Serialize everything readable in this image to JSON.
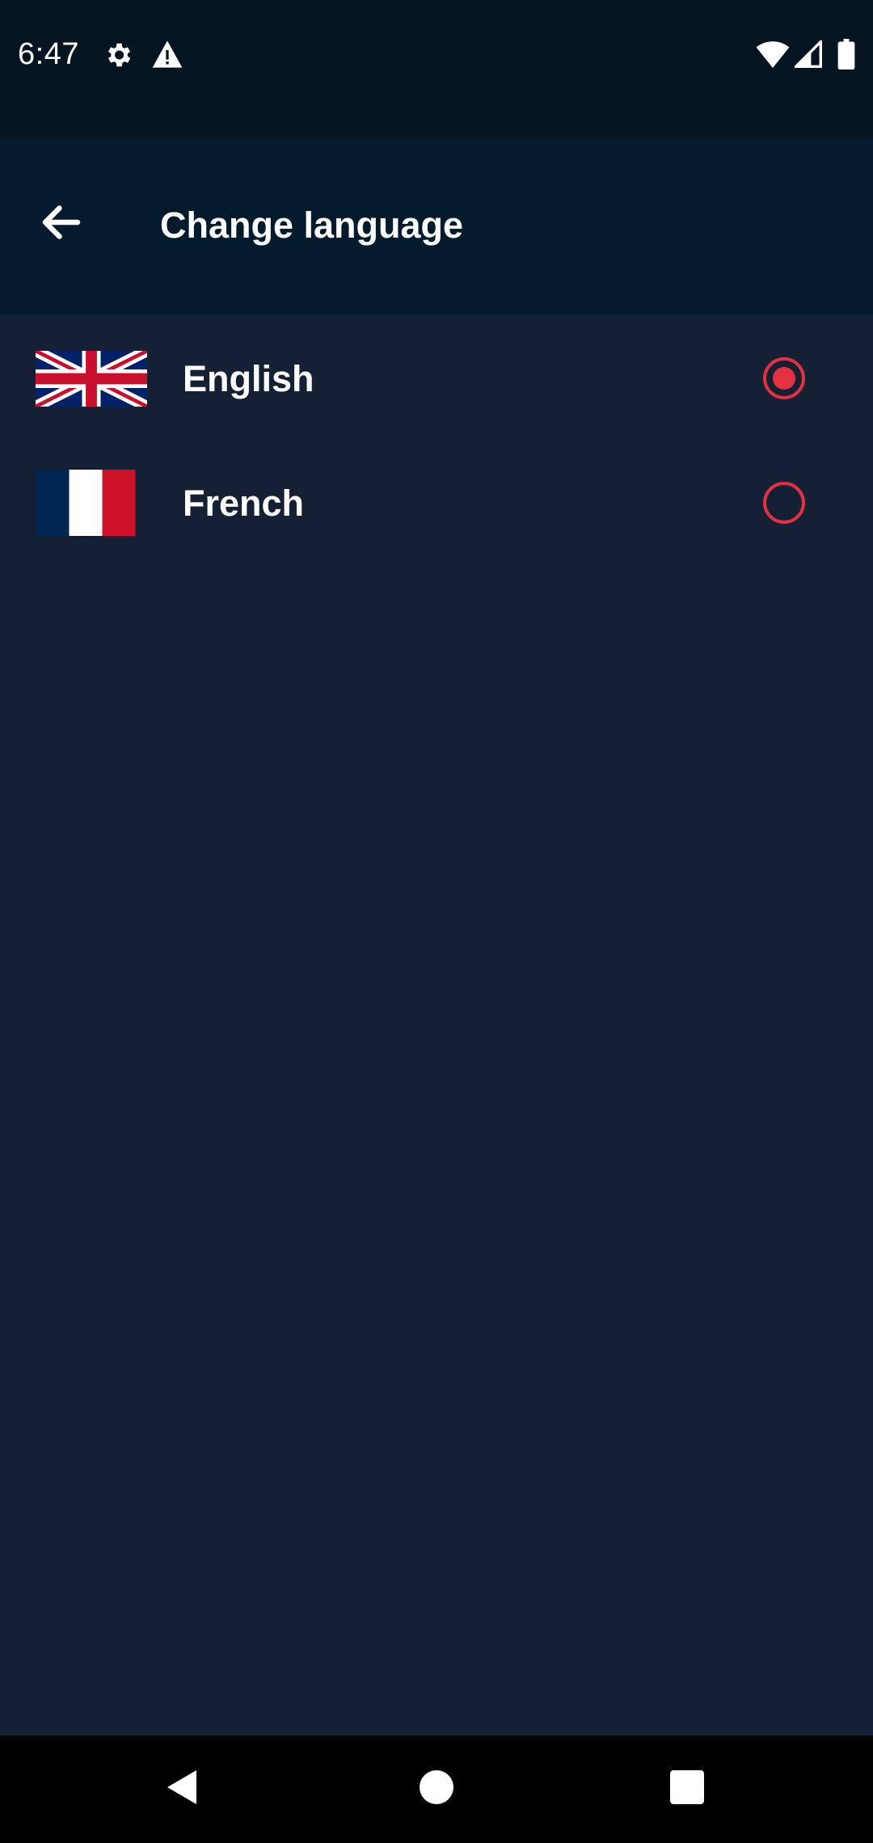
{
  "status_bar": {
    "time": "6:47",
    "icons": [
      "gear-icon",
      "warning-icon",
      "wifi-icon",
      "signal-icon",
      "battery-icon"
    ]
  },
  "app_bar": {
    "title": "Change language",
    "back_icon": "arrow-left-icon"
  },
  "languages": [
    {
      "label": "English",
      "flag": "uk-flag-icon",
      "selected": true
    },
    {
      "label": "French",
      "flag": "france-flag-icon",
      "selected": false
    }
  ],
  "nav_bar": {
    "buttons": [
      "back-triangle-icon",
      "home-circle-icon",
      "recents-square-icon"
    ]
  },
  "colors": {
    "background": "#162034",
    "app_bar": "#031b2d",
    "status_bar": "#041420",
    "accent": "#e2323f",
    "nav_bar": "#000000"
  }
}
